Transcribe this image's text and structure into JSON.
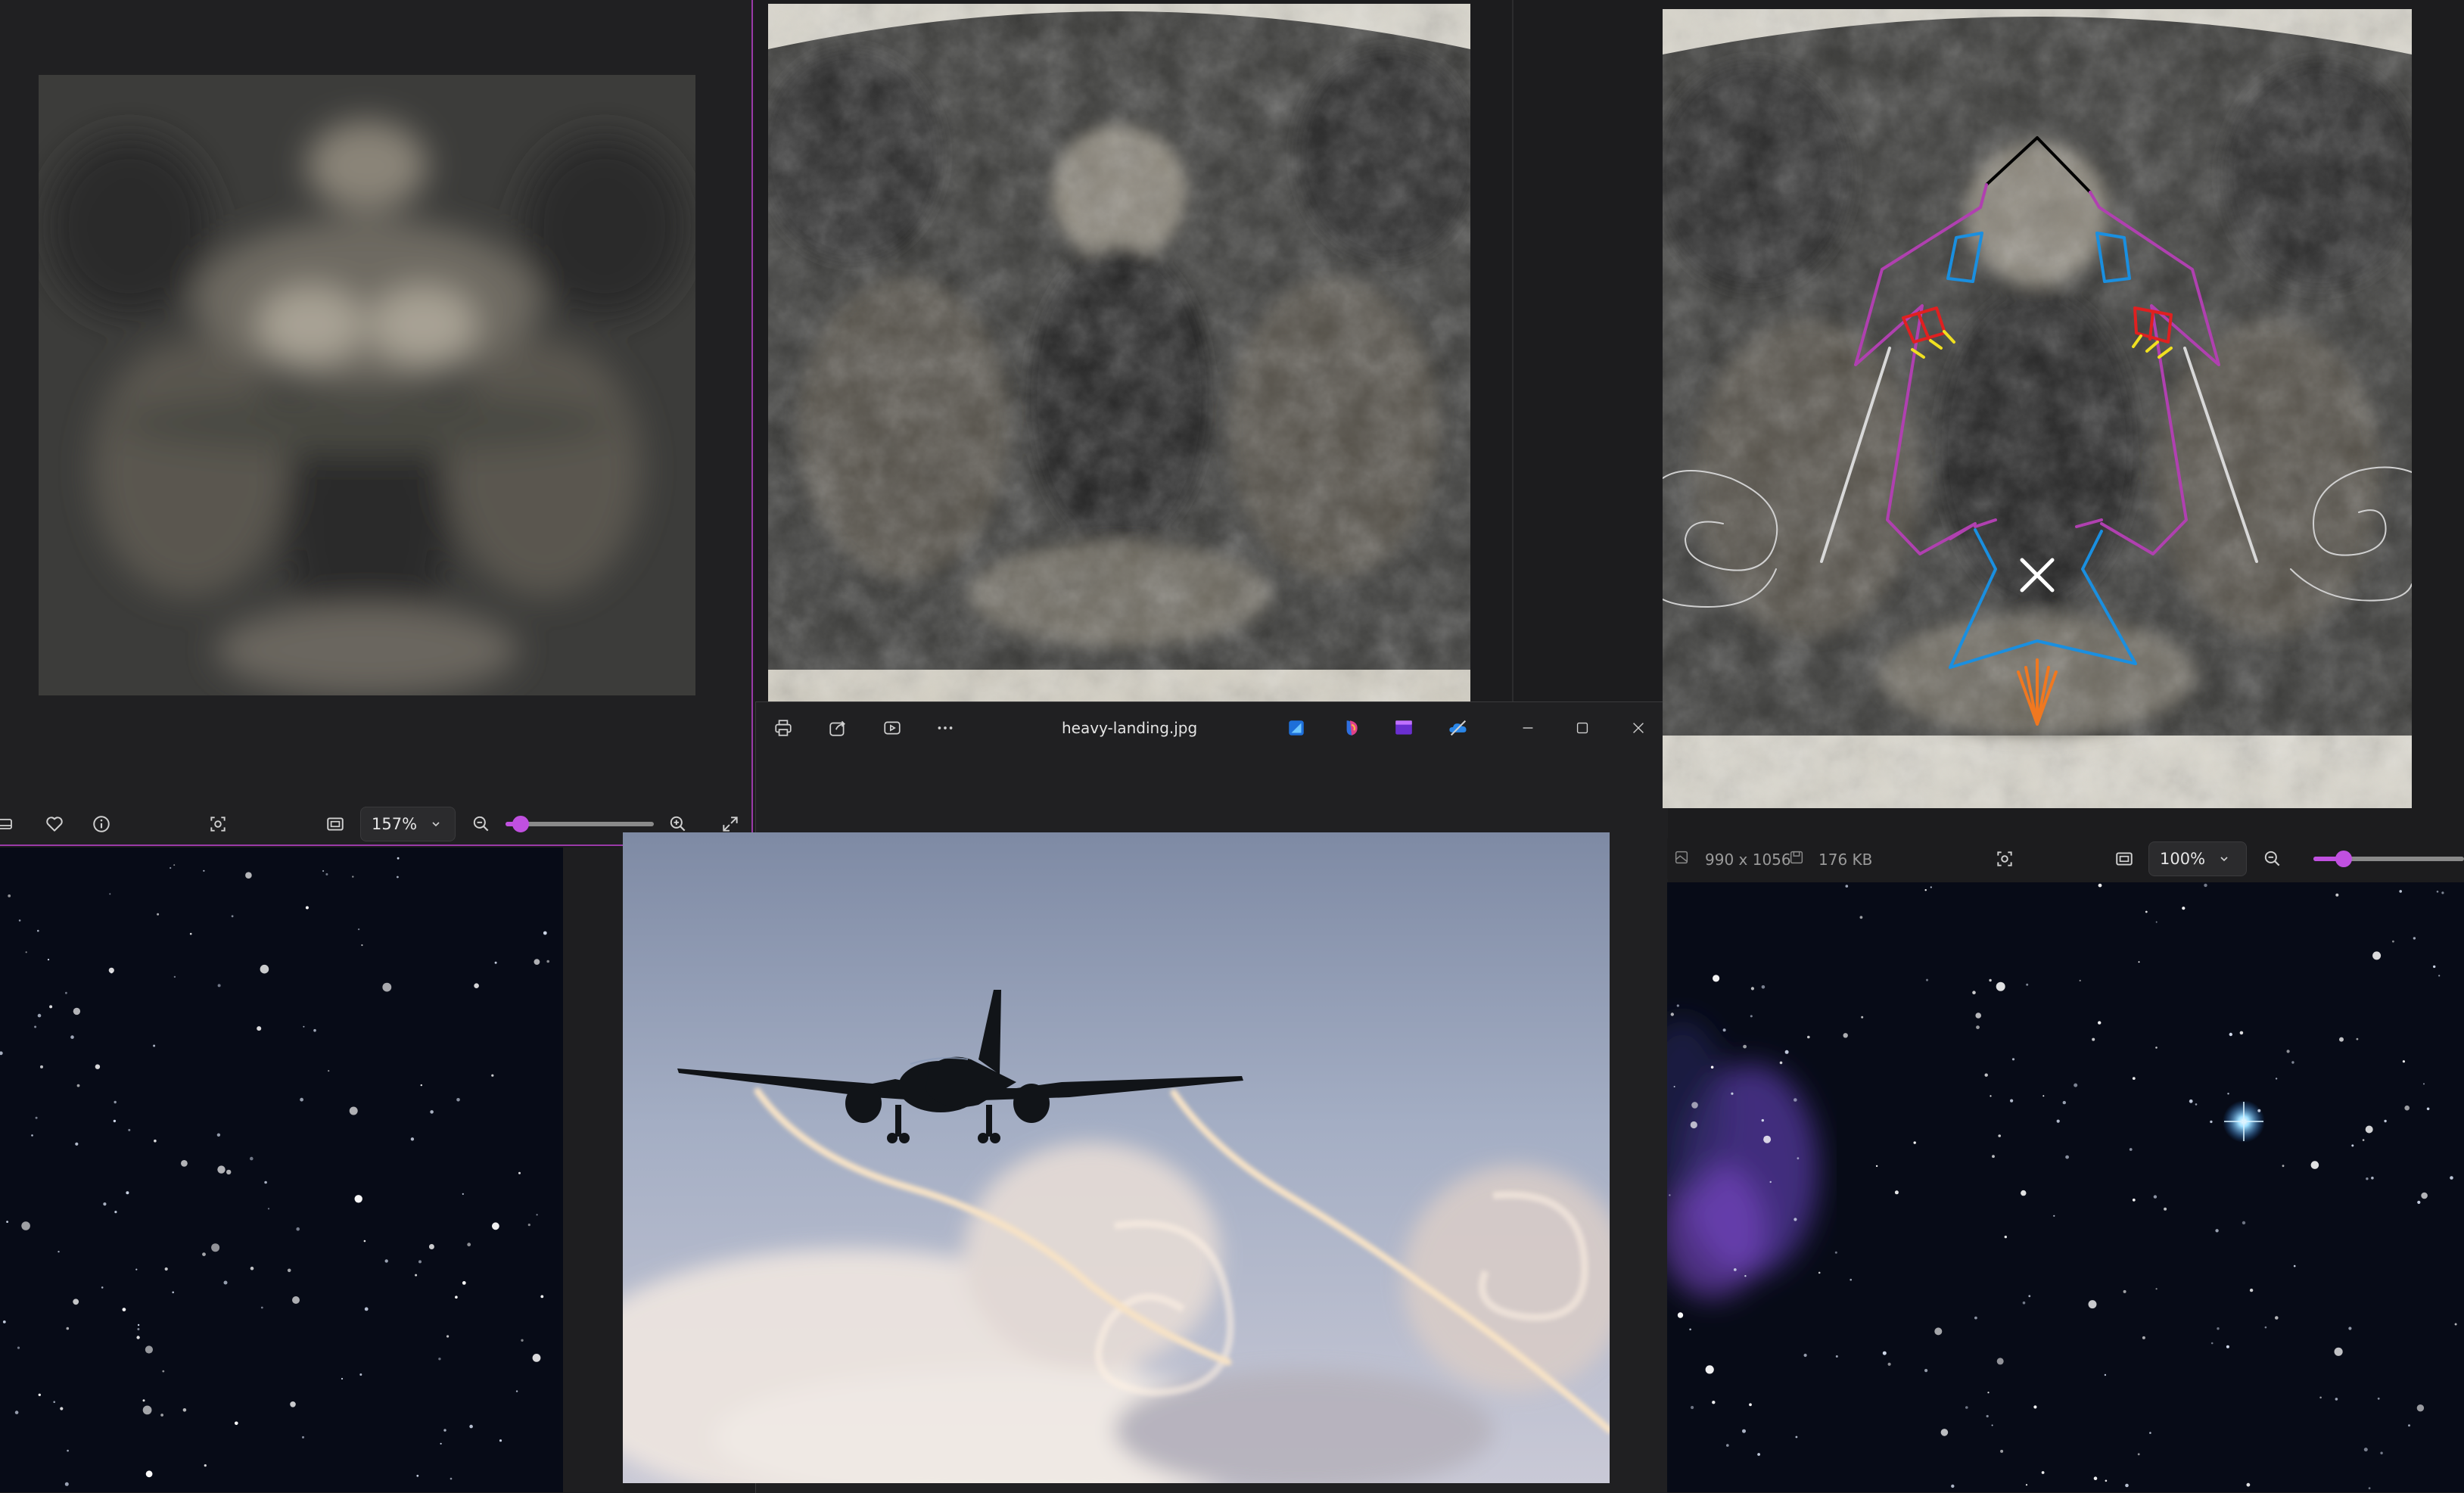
{
  "accent": "#c050e0",
  "background": "#1c1c1e",
  "viewer_left": {
    "zoom_value": "157%",
    "zoom_level": 0.1,
    "icons": [
      "filmstrip-icon",
      "heart-icon",
      "info-icon",
      "face-scan-icon",
      "fit-icon",
      "zoom-out-icon",
      "zoom-in-icon",
      "fullscreen-icon"
    ]
  },
  "viewer_center": {
    "title": "heavy-landing.jpg",
    "icons": [
      "print-icon",
      "share-icon",
      "slideshow-icon",
      "more-icon",
      "designer-icon",
      "copilot-icon",
      "clipchamp-icon",
      "onedrive-icon",
      "minimize-icon",
      "maximize-icon",
      "close-icon"
    ]
  },
  "viewer_right": {
    "dimensions": "990 x 1056",
    "file_size": "176 KB",
    "zoom_value": "100%",
    "zoom_level": 0.2
  },
  "diagram_colors": {
    "nose": "#000000",
    "body": "#b040b0",
    "windows": "#1a8fe0",
    "engines": "#e02020",
    "exhaust": "#f0e020",
    "wing_lines": "#d8d8d8",
    "tail": "#1a8fe0",
    "center_mark": "#ffffff",
    "arrow": "#f07820",
    "spirals": "#d0d0d0"
  }
}
